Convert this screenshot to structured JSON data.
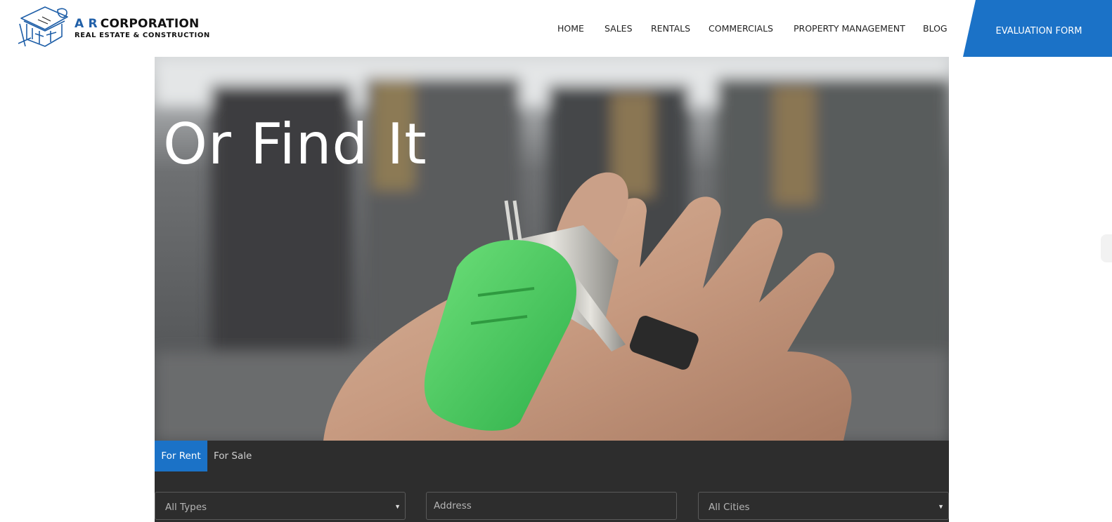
{
  "brand": {
    "name_prefix": "A R",
    "name_main": "CORPORATION",
    "tagline": "REAL ESTATE & CONSTRUCTION",
    "logo_icon": "blueprint-house-icon",
    "accent_color": "#1f5fa8"
  },
  "nav": {
    "items": [
      {
        "label": "HOME"
      },
      {
        "label": "SALES"
      },
      {
        "label": "RENTALS"
      },
      {
        "label": "COMMERCIALS"
      },
      {
        "label": "PROPERTY MANAGEMENT"
      },
      {
        "label": "BLOG"
      }
    ],
    "cta_label": "EVALUATION FORM",
    "cta_color": "#1b72c7"
  },
  "hero": {
    "title": "Or Find It",
    "image_subject": "hand-holding-keys-image"
  },
  "search": {
    "tabs": [
      {
        "label": "For Rent",
        "active": true
      },
      {
        "label": "For Sale",
        "active": false
      }
    ],
    "type_select": {
      "selected": "All Types"
    },
    "address": {
      "placeholder": "Address",
      "value": ""
    },
    "city_select": {
      "selected": "All Cities"
    },
    "panel_color": "#2d2d2d",
    "active_tab_color": "#1b72c7"
  }
}
